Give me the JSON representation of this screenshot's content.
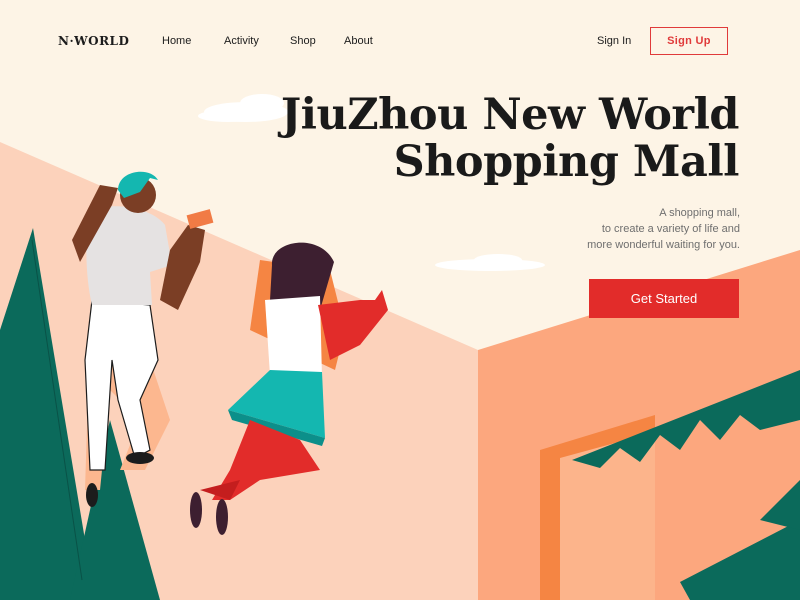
{
  "nav": {
    "logo": "N·WORLD",
    "links": [
      "Home",
      "Activity",
      "Shop",
      "About"
    ],
    "sign_in": "Sign In",
    "sign_up": "Sign Up"
  },
  "hero": {
    "title_line1": "JiuZhou New World",
    "title_line2": "Shopping Mall",
    "subtitle_line1": "A shopping mall,",
    "subtitle_line2": "to create a variety of life and",
    "subtitle_line3": "more wonderful waiting for you.",
    "cta": "Get Started"
  },
  "colors": {
    "background": "#fdf4e6",
    "accent": "#e22c2a",
    "building_pink": "#fcd2bb",
    "building_orange": "#fca77e",
    "tree_green": "#0b6a5b",
    "teal": "#14b7b0"
  }
}
